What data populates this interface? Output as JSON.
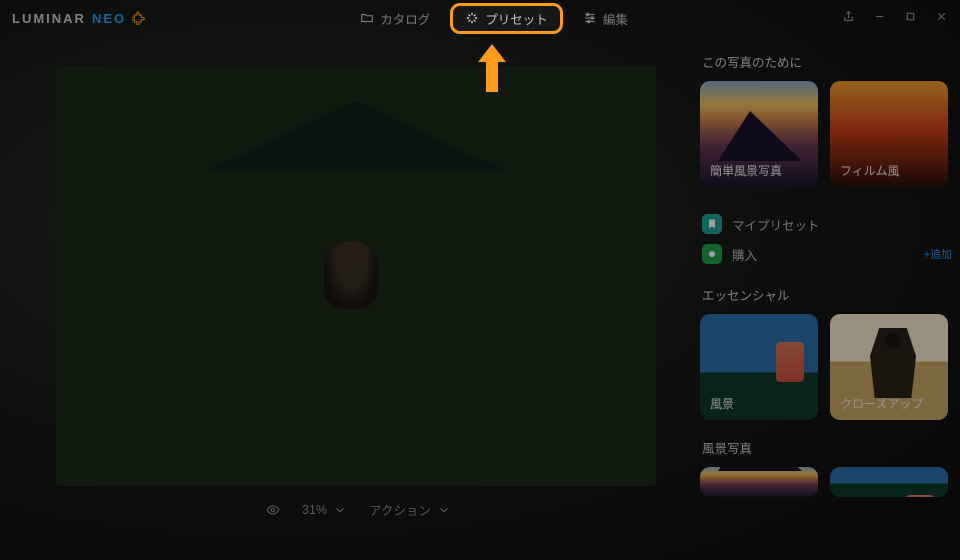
{
  "app": {
    "logo_main": "LUMINAR",
    "logo_sub": "NEO"
  },
  "nav": {
    "catalog": "カタログ",
    "presets": "プリセット",
    "edit": "編集",
    "active": "presets"
  },
  "bottombar": {
    "zoom": "31%",
    "action": "アクション"
  },
  "panel": {
    "for_this_photo": "この写真のために",
    "cards_top": [
      {
        "id": "easy-landscape",
        "label": "簡単風景写真"
      },
      {
        "id": "film",
        "label": "フィルム風"
      }
    ],
    "my_presets": "マイプリセット",
    "purchase": "購入",
    "purchase_extra": "+追加",
    "essential": "エッセンシャル",
    "cards_mid": [
      {
        "id": "landscape",
        "label": "風景"
      },
      {
        "id": "closeup",
        "label": "クローズアップ"
      }
    ],
    "landscape_photo": "風景写真"
  }
}
